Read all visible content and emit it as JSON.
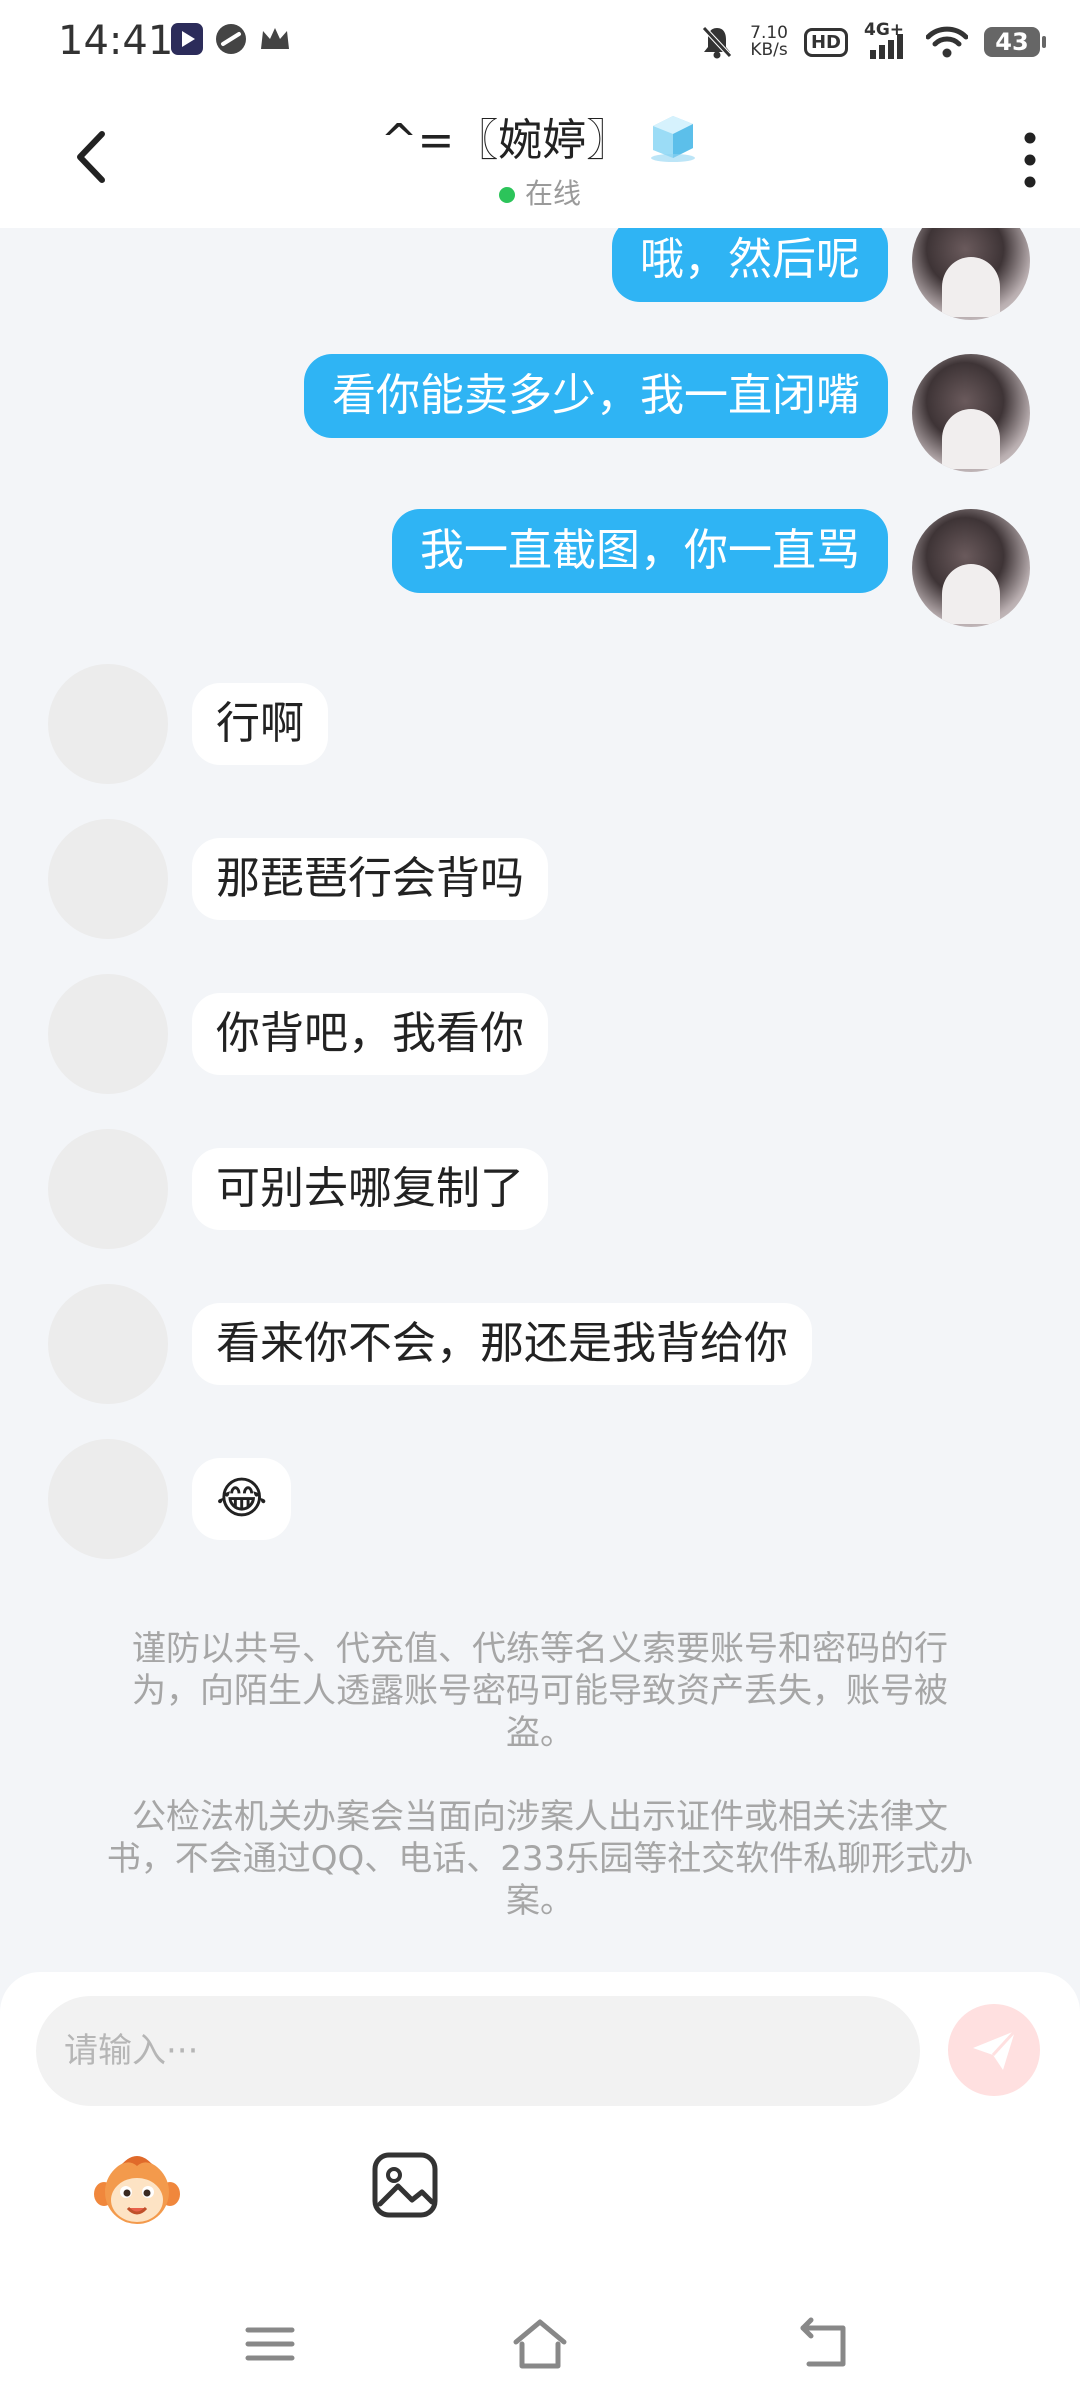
{
  "status_bar": {
    "time": "14:41",
    "net_speed_value": "7.10",
    "net_speed_unit": "KB/s",
    "hd_label": "HD",
    "signal_label": "4G+",
    "battery": "43"
  },
  "header": {
    "title": "^=〖婉婷〗",
    "status": "在线"
  },
  "messages_me": [
    {
      "text": "哦，然后呢"
    },
    {
      "text": "看你能卖多少，我一直闭嘴"
    },
    {
      "text": "我一直截图，你一直骂"
    }
  ],
  "messages_other": [
    {
      "text": "行啊"
    },
    {
      "text": "那琵琶行会背吗"
    },
    {
      "text": "你背吧，我看你"
    },
    {
      "text": "可别去哪复制了"
    },
    {
      "text": "看来你不会，那还是我背给你"
    },
    {
      "text": "😂"
    }
  ],
  "notices": [
    "谨防以共号、代充值、代练等名义索要账号和密码的行为，向陌生人透露账号密码可能导致资产丢失，账号被盗。",
    "公检法机关办案会当面向涉案人出示证件或相关法律文书，不会通过QQ、电话、233乐园等社交软件私聊形式办案。"
  ],
  "input": {
    "placeholder": "请输入···"
  },
  "colors": {
    "bubble_me": "#2fb4f4",
    "bubble_other": "#ffffff",
    "background": "#f3f5f8",
    "online": "#2cc45a"
  }
}
